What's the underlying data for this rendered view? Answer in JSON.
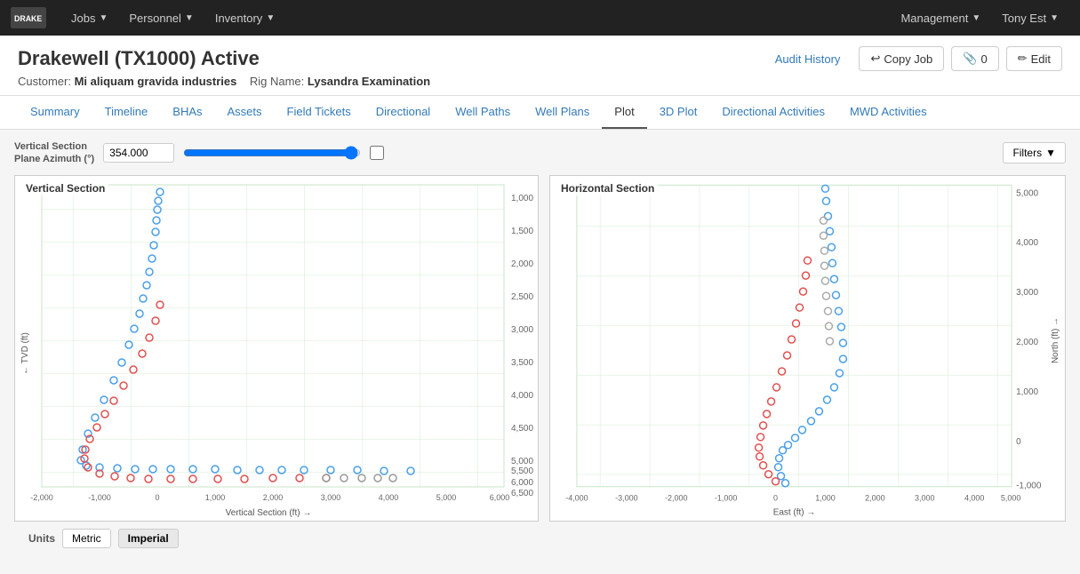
{
  "navbar": {
    "logo_text": "DRAKE",
    "jobs_label": "Jobs",
    "personnel_label": "Personnel",
    "inventory_label": "Inventory",
    "management_label": "Management",
    "user_label": "Tony Est"
  },
  "job_header": {
    "title": "Drakewell (TX1000) Active",
    "customer_label": "Customer:",
    "customer_name": "Mi aliquam gravida industries",
    "rig_label": "Rig Name:",
    "rig_name": "Lysandra Examination",
    "audit_history_btn": "Audit History",
    "copy_job_btn": "Copy Job",
    "attachments_count": "0",
    "edit_btn": "Edit"
  },
  "tabs": [
    {
      "id": "summary",
      "label": "Summary"
    },
    {
      "id": "timeline",
      "label": "Timeline"
    },
    {
      "id": "bhas",
      "label": "BHAs"
    },
    {
      "id": "assets",
      "label": "Assets"
    },
    {
      "id": "field_tickets",
      "label": "Field Tickets"
    },
    {
      "id": "directional",
      "label": "Directional"
    },
    {
      "id": "well_paths",
      "label": "Well Paths"
    },
    {
      "id": "well_plans",
      "label": "Well Plans"
    },
    {
      "id": "plot",
      "label": "Plot"
    },
    {
      "id": "3d_plot",
      "label": "3D Plot"
    },
    {
      "id": "directional_activities",
      "label": "Directional Activities"
    },
    {
      "id": "mwd_activities",
      "label": "MWD Activities"
    }
  ],
  "active_tab": "plot",
  "plot_controls": {
    "plane_azimuth_label": "Vertical Section\nPlane Azimuth (°)",
    "plane_azimuth_value": "354.000",
    "filters_btn": "Filters"
  },
  "vertical_section": {
    "title": "Vertical Section",
    "x_axis_label": "Vertical Section (ft) →",
    "y_axis_label": "← TVD (ft)",
    "x_ticks": [
      "-2,000",
      "-1,000",
      "0",
      "1,000",
      "2,000",
      "3,000",
      "4,000",
      "5,000",
      "6,000"
    ],
    "y_ticks": [
      "1,000",
      "1,500",
      "2,000",
      "2,500",
      "3,000",
      "3,500",
      "4,000",
      "4,500",
      "5,000",
      "5,500",
      "6,000",
      "6,500"
    ]
  },
  "horizontal_section": {
    "title": "Horizontal Section",
    "x_axis_label": "East (ft) →",
    "y_axis_label": "North (ft) →",
    "x_ticks": [
      "-4,000",
      "-3,000",
      "-2,000",
      "-1,000",
      "0",
      "1,000",
      "2,000",
      "3,000",
      "4,000",
      "5,000"
    ],
    "y_ticks": [
      "-1,000",
      "0",
      "1,000",
      "2,000",
      "3,000",
      "4,000",
      "5,000"
    ]
  },
  "units": {
    "label": "Units",
    "metric_label": "Metric",
    "imperial_label": "Imperial",
    "active": "Imperial"
  }
}
